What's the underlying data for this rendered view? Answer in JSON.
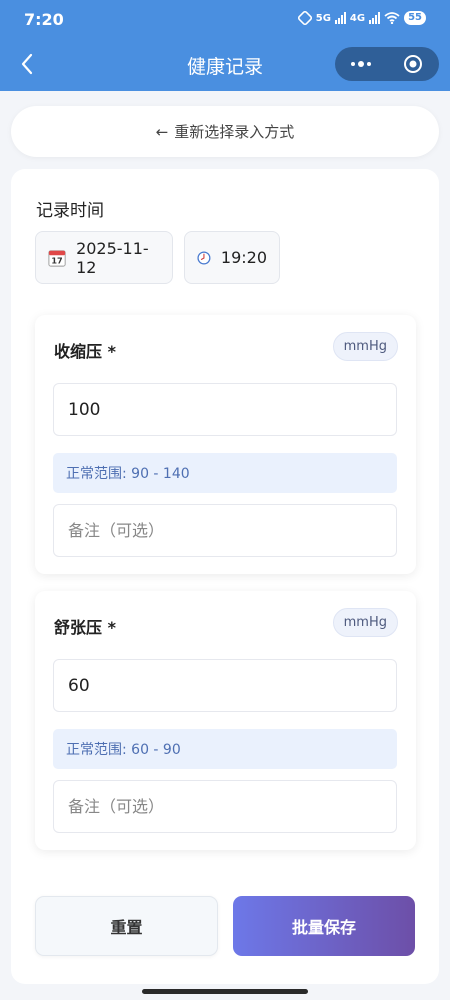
{
  "status_bar": {
    "time": "7:20",
    "net1": "5G",
    "net2": "4G",
    "battery": "55"
  },
  "nav": {
    "title": "健康记录"
  },
  "reselect": {
    "arrow": "←",
    "label": "重新选择录入方式"
  },
  "record_time": {
    "label": "记录时间",
    "date_icon": "calendar-icon",
    "date": "2025-11-12",
    "time_icon": "clock-icon",
    "time": "19:20"
  },
  "sections": [
    {
      "title": "收缩压 *",
      "unit": "mmHg",
      "value": "100",
      "range_text": "正常范围: 90 - 140",
      "note_placeholder": "备注（可选）"
    },
    {
      "title": "舒张压 *",
      "unit": "mmHg",
      "value": "60",
      "range_text": "正常范围: 60 - 90",
      "note_placeholder": "备注（可选）"
    }
  ],
  "buttons": {
    "reset": "重置",
    "save": "批量保存"
  },
  "colors": {
    "header": "#4a8fe0",
    "save_start": "#6d78e8",
    "save_end": "#6d4fa8",
    "range_bg": "#eaf1fd"
  }
}
